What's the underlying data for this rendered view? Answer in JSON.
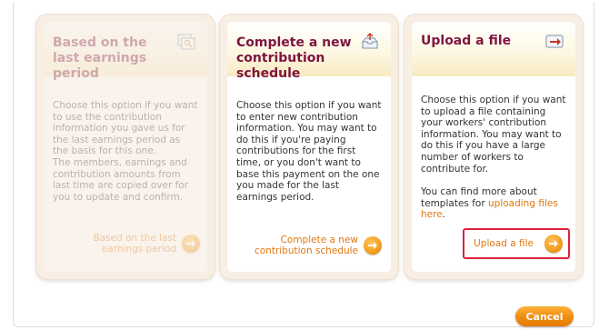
{
  "cards": [
    {
      "title": "Based on the last earnings period",
      "description": [
        "Choose this option if you want to use the contribution information you gave us for the last earnings period as the basis for this one.",
        "The members, earnings and contribution amounts from last time are copied over for you to update and confirm."
      ],
      "action_label": "Based on the last earnings period",
      "icon": "copy-document-icon",
      "state": "disabled"
    },
    {
      "title": "Complete a new contribution schedule",
      "description": [
        "Choose this option if you want to enter new contribution information. You may want to do this if you're paying contributions for the first time, or you don't want to base this payment on the one you made for the last earnings period."
      ],
      "action_label": "Complete a new contribution schedule",
      "icon": "inbox-tray-icon",
      "state": "enabled"
    },
    {
      "title": "Upload a file",
      "description": [
        "Choose this option if you want to upload a file containing your workers' contribution information. You may want to do this if you have a large number of workers to contribute for."
      ],
      "templates_prefix": "You can find more about templates for",
      "templates_link": "uploading files here",
      "templates_suffix": ".",
      "action_label": "Upload a file",
      "icon": "upload-file-icon",
      "state": "enabled"
    }
  ],
  "cancel_label": "Cancel",
  "colors": {
    "title": "#7d1540",
    "link": "#e07810",
    "button_orange": "#f08c10",
    "highlight_border": "#e0213a",
    "card_bg": "#f7eee4"
  }
}
